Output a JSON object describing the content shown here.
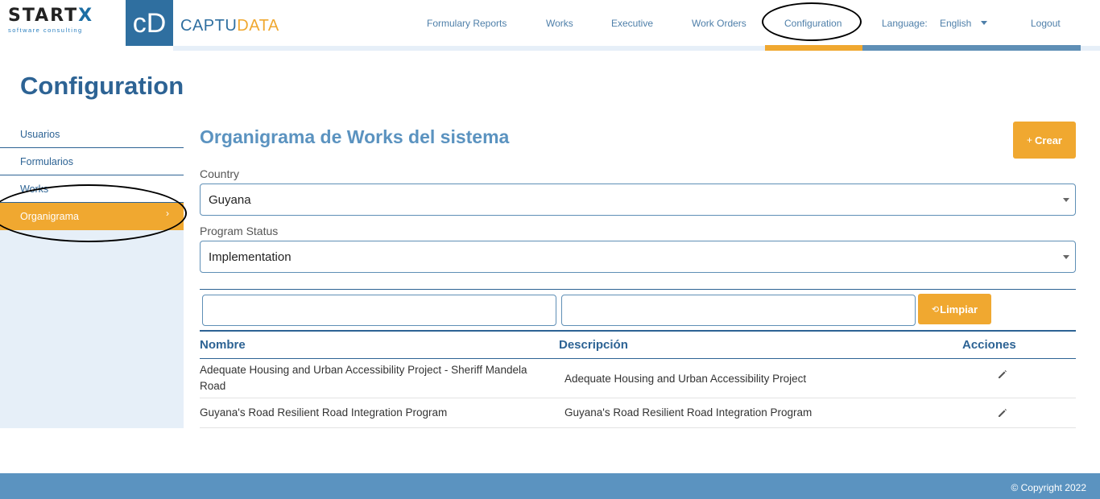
{
  "brand": {
    "startx_word_a": "START",
    "startx_word_b": "X",
    "startx_tagline": "software consulting",
    "cd_mark": "cD",
    "captudata_a": "CAPTU",
    "captudata_b": "DATA"
  },
  "nav": {
    "items": [
      "Formulary Reports",
      "Works",
      "Executive",
      "Work Orders",
      "Configuration"
    ],
    "active": "Configuration",
    "language_label": "Language:",
    "language_value": "English",
    "logout": "Logout"
  },
  "page": {
    "title": "Configuration"
  },
  "sidebar": {
    "items": [
      {
        "label": "Usuarios"
      },
      {
        "label": "Formularios"
      },
      {
        "label": "Works"
      },
      {
        "label": "Organigrama",
        "active": true
      }
    ]
  },
  "main": {
    "title": "Organigrama de Works del sistema",
    "create_button": "Crear",
    "country": {
      "label": "Country",
      "value": "Guyana"
    },
    "program_status": {
      "label": "Program Status",
      "value": "Implementation"
    },
    "filter": {
      "name_value": "",
      "description_value": "",
      "clear_button": "Limpiar"
    },
    "table": {
      "columns": [
        "Nombre",
        "Descripción",
        "Acciones"
      ],
      "rows": [
        {
          "nombre": "Adequate Housing and Urban Accessibility Project - Sheriff Mandela Road",
          "descripcion": "Adequate Housing and Urban Accessibility Project"
        },
        {
          "nombre": "Guyana's Road Resilient Road Integration Program",
          "descripcion": "Guyana's Road Resilient Road Integration Program"
        }
      ]
    }
  },
  "footer": {
    "copyright": "© Copyright 2022"
  },
  "colors": {
    "primary": "#2d6394",
    "accent": "#f0a830",
    "sidebar_bg": "#e6eff8",
    "footer_bg": "#5b93c0"
  },
  "icons": {
    "edit": "pencil-icon",
    "clear": "refresh-icon",
    "create": "plus-icon",
    "caret": "caret-down-icon"
  }
}
